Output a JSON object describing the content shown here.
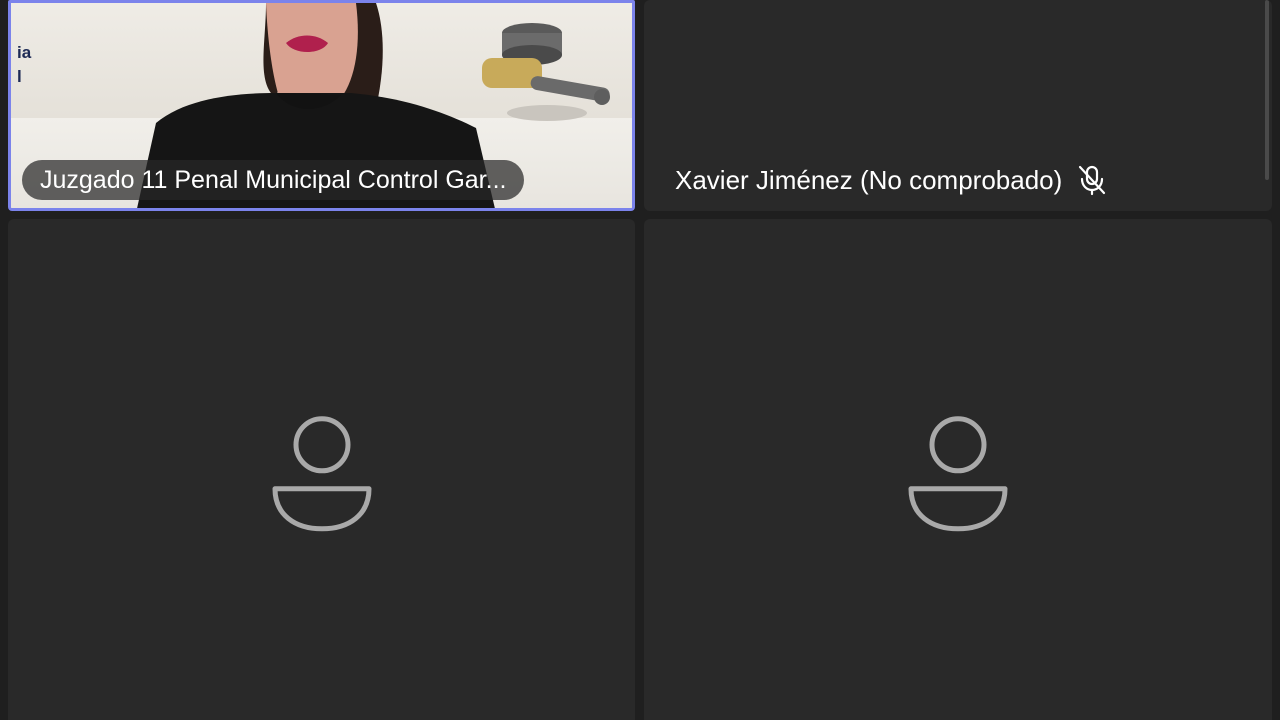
{
  "tiles": [
    {
      "id": "juzgado",
      "name": "Juzgado 11 Penal Municipal Control Gar...",
      "video": true,
      "backdrop_text": [
        "ia",
        "l"
      ]
    },
    {
      "id": "xavier",
      "name": "Xavier Jiménez  (No comprobado)",
      "muted": true,
      "video": false
    },
    {
      "id": "participant-3",
      "video": false
    },
    {
      "id": "participant-4",
      "video": false
    }
  ],
  "colors": {
    "background": "#1f1f1f",
    "tile": "#292929",
    "active_speaker_border": "#7b83eb",
    "avatar_stroke": "#a9a9a9"
  },
  "icons": {
    "muted": "mic-off-icon",
    "avatar": "person-placeholder-icon"
  }
}
